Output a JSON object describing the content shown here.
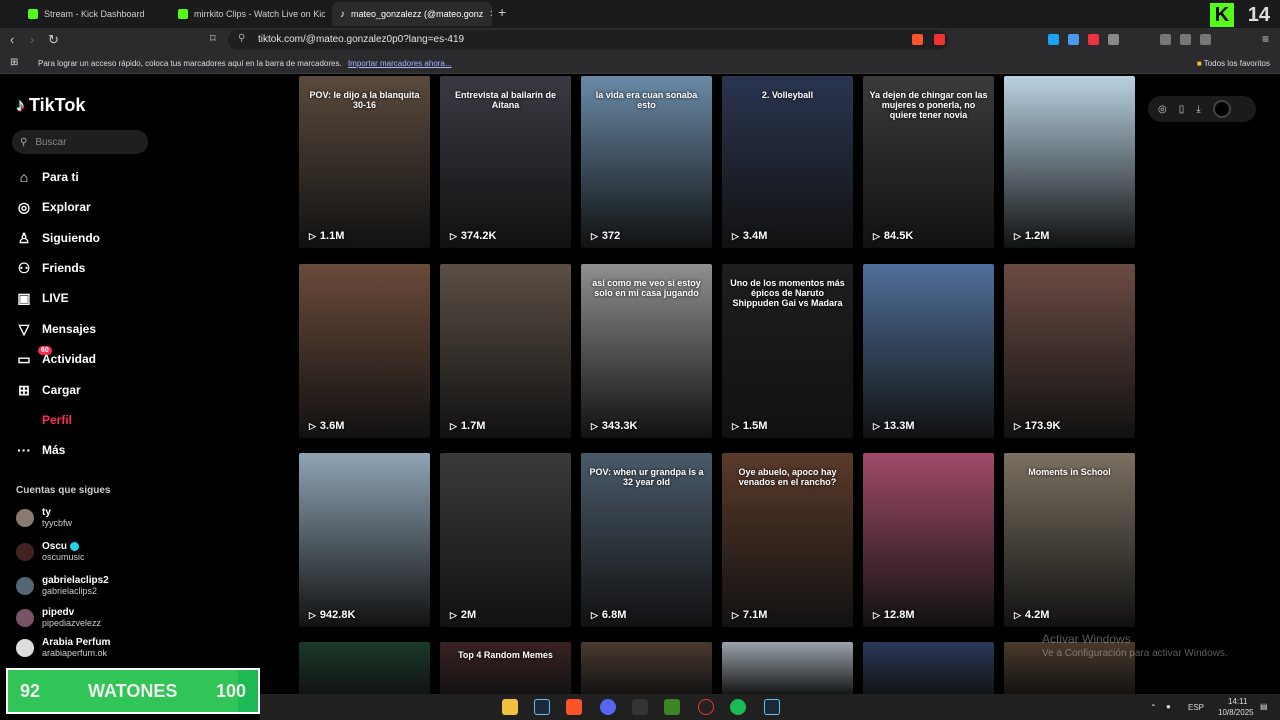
{
  "browser": {
    "tabs": [
      {
        "title": "Stream - Kick Dashboard",
        "color": "#53fc18"
      },
      {
        "title": "mirrkito Clips - Watch Live on Kic",
        "color": "#53fc18"
      },
      {
        "title": "mateo_gonzalezz (@mateo.gonz",
        "color": "#ffffff"
      }
    ],
    "kick_count": "14",
    "url": "tiktok.com/@mateo.gonzalez0p0?lang=es-419",
    "bookmarks_text": "Para lograr un acceso rápido, coloca tus marcadores aquí en la barra de marcadores.",
    "bookmarks_link": "Importar marcadores ahora...",
    "bookmarks_right": "Todos los favoritos"
  },
  "sidebar": {
    "logo": "TikTok",
    "search_placeholder": "Buscar",
    "items": [
      {
        "label": "Para ti",
        "icon": "home-icon"
      },
      {
        "label": "Explorar",
        "icon": "compass-icon"
      },
      {
        "label": "Siguiendo",
        "icon": "following-icon"
      },
      {
        "label": "Friends",
        "icon": "friends-icon"
      },
      {
        "label": "LIVE",
        "icon": "live-icon"
      },
      {
        "label": "Mensajes",
        "icon": "send-icon"
      },
      {
        "label": "Actividad",
        "icon": "inbox-icon",
        "badge": "60"
      },
      {
        "label": "Cargar",
        "icon": "upload-icon"
      },
      {
        "label": "Perfil",
        "icon": "profile-icon"
      },
      {
        "label": "Más",
        "icon": "more-icon"
      }
    ],
    "following_title": "Cuentas que sigues",
    "following": [
      {
        "name": "ty",
        "handle": "tyycbfw"
      },
      {
        "name": "Oscu",
        "handle": "oscumusic",
        "verified": true
      },
      {
        "name": "gabrielaclips2",
        "handle": "gabrielaclips2"
      },
      {
        "name": "pipedv",
        "handle": "pipediazvelezz"
      },
      {
        "name": "Arabia Perfum",
        "handle": "arabiaperfum.ok"
      }
    ]
  },
  "videos": [
    {
      "views": "1.1M",
      "caption": "POV: le dijo a la blanquita 30-16",
      "bg": "#5a4a3d"
    },
    {
      "views": "374.2K",
      "caption": "Entrevista al bailarín de Aitana",
      "bg": "#3a3a44"
    },
    {
      "views": "372",
      "caption": "la vida era cuan sonaba esto",
      "bg": "#6a8aa8"
    },
    {
      "views": "3.4M",
      "caption": "2. Volleyball",
      "bg": "#2a3550"
    },
    {
      "views": "84.5K",
      "caption": "Ya dejen de chingar con las mujeres o ponerla, no quiere tener novia",
      "bg": "#3b3b3b"
    },
    {
      "views": "1.2M",
      "caption": "",
      "bg": "#b9d2e2"
    },
    {
      "views": "3.6M",
      "caption": "",
      "bg": "#6b4a3a"
    },
    {
      "views": "1.7M",
      "caption": "",
      "bg": "#5b4f45"
    },
    {
      "views": "343.3K",
      "caption": "así como me veo si estoy solo en mi casa jugando",
      "bg": "#8f8f8f"
    },
    {
      "views": "1.5M",
      "caption": "Uno de los momentos más épicos de Naruto Shippuden Gai vs Madara",
      "bg": "#1e1e1e"
    },
    {
      "views": "13.3M",
      "caption": "",
      "bg": "#4f6f9a"
    },
    {
      "views": "173.9K",
      "caption": "",
      "bg": "#6b4b43"
    },
    {
      "views": "942.8K",
      "caption": "",
      "bg": "#8fa4b4"
    },
    {
      "views": "2M",
      "caption": "",
      "bg": "#3a3a3a"
    },
    {
      "views": "6.8M",
      "caption": "POV: when ur grandpa is a 32 year old",
      "bg": "#4a5a6a"
    },
    {
      "views": "7.1M",
      "caption": "Oye abuelo, apoco hay venados en el rancho?",
      "bg": "#5a3a2a"
    },
    {
      "views": "12.8M",
      "caption": "",
      "bg": "#a04a6a"
    },
    {
      "views": "4.2M",
      "caption": "Moments in School",
      "bg": "#7a7060"
    },
    {
      "views": "",
      "caption": "",
      "bg": "#1a3a2a"
    },
    {
      "views": "",
      "caption": "Top 4 Random Memes",
      "bg": "#3a2222"
    },
    {
      "views": "",
      "caption": "",
      "bg": "#4a3a30"
    },
    {
      "views": "",
      "caption": "",
      "bg": "#9aa4ac"
    },
    {
      "views": "",
      "caption": "",
      "bg": "#2a3a5a"
    },
    {
      "views": "",
      "caption": "",
      "bg": "#4a3a2a"
    }
  ],
  "watermark": {
    "line1": "Activar Windows",
    "line2": "Ve a Configuración para activar Windows."
  },
  "overlay": {
    "left": "92",
    "label": "WATONES",
    "right": "100",
    "progress": 0.92
  },
  "taskbar": {
    "lang": "ESP",
    "time": "14:11",
    "date": "10/8/2025"
  }
}
